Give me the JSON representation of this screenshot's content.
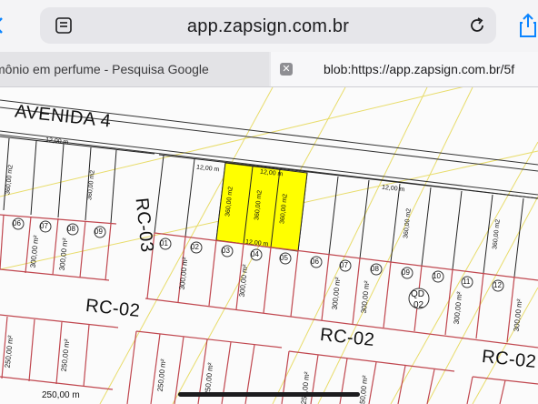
{
  "browser": {
    "url": "app.zapsign.com.br",
    "tabs": [
      {
        "label": "mônio em perfume - Pesquisa Google"
      },
      {
        "label": "blob:https://app.zapsign.com.br/5f"
      }
    ],
    "close_symbol": "✕"
  },
  "icons": {
    "tabs": "tabs-icon",
    "reload": "reload-icon",
    "share": "share-icon",
    "page": "page-icon"
  },
  "map": {
    "streets": {
      "avenida": "AVENIDA 4",
      "rc03": "RC-03",
      "rc02_left": "RC-02",
      "rc02_center": "RC-02",
      "rc02_right": "RC-02"
    },
    "block_label": {
      "line1": "QD",
      "line2": "02"
    },
    "dim_label": "12,00 m",
    "area_upper": "360,00 m2",
    "area_lower": "300,00 m²",
    "area_bottom": "250,00 m²",
    "bottom_left": "250,00 m",
    "lot_numbers_lower": [
      "06",
      "07",
      "08",
      "09",
      "01",
      "02",
      "03",
      "04",
      "05",
      "06",
      "07",
      "08",
      "09",
      "10",
      "11",
      "12"
    ],
    "highlight_color": "#ffff00",
    "line_red": "#c0474f",
    "line_yellow": "#e8dc6a"
  }
}
